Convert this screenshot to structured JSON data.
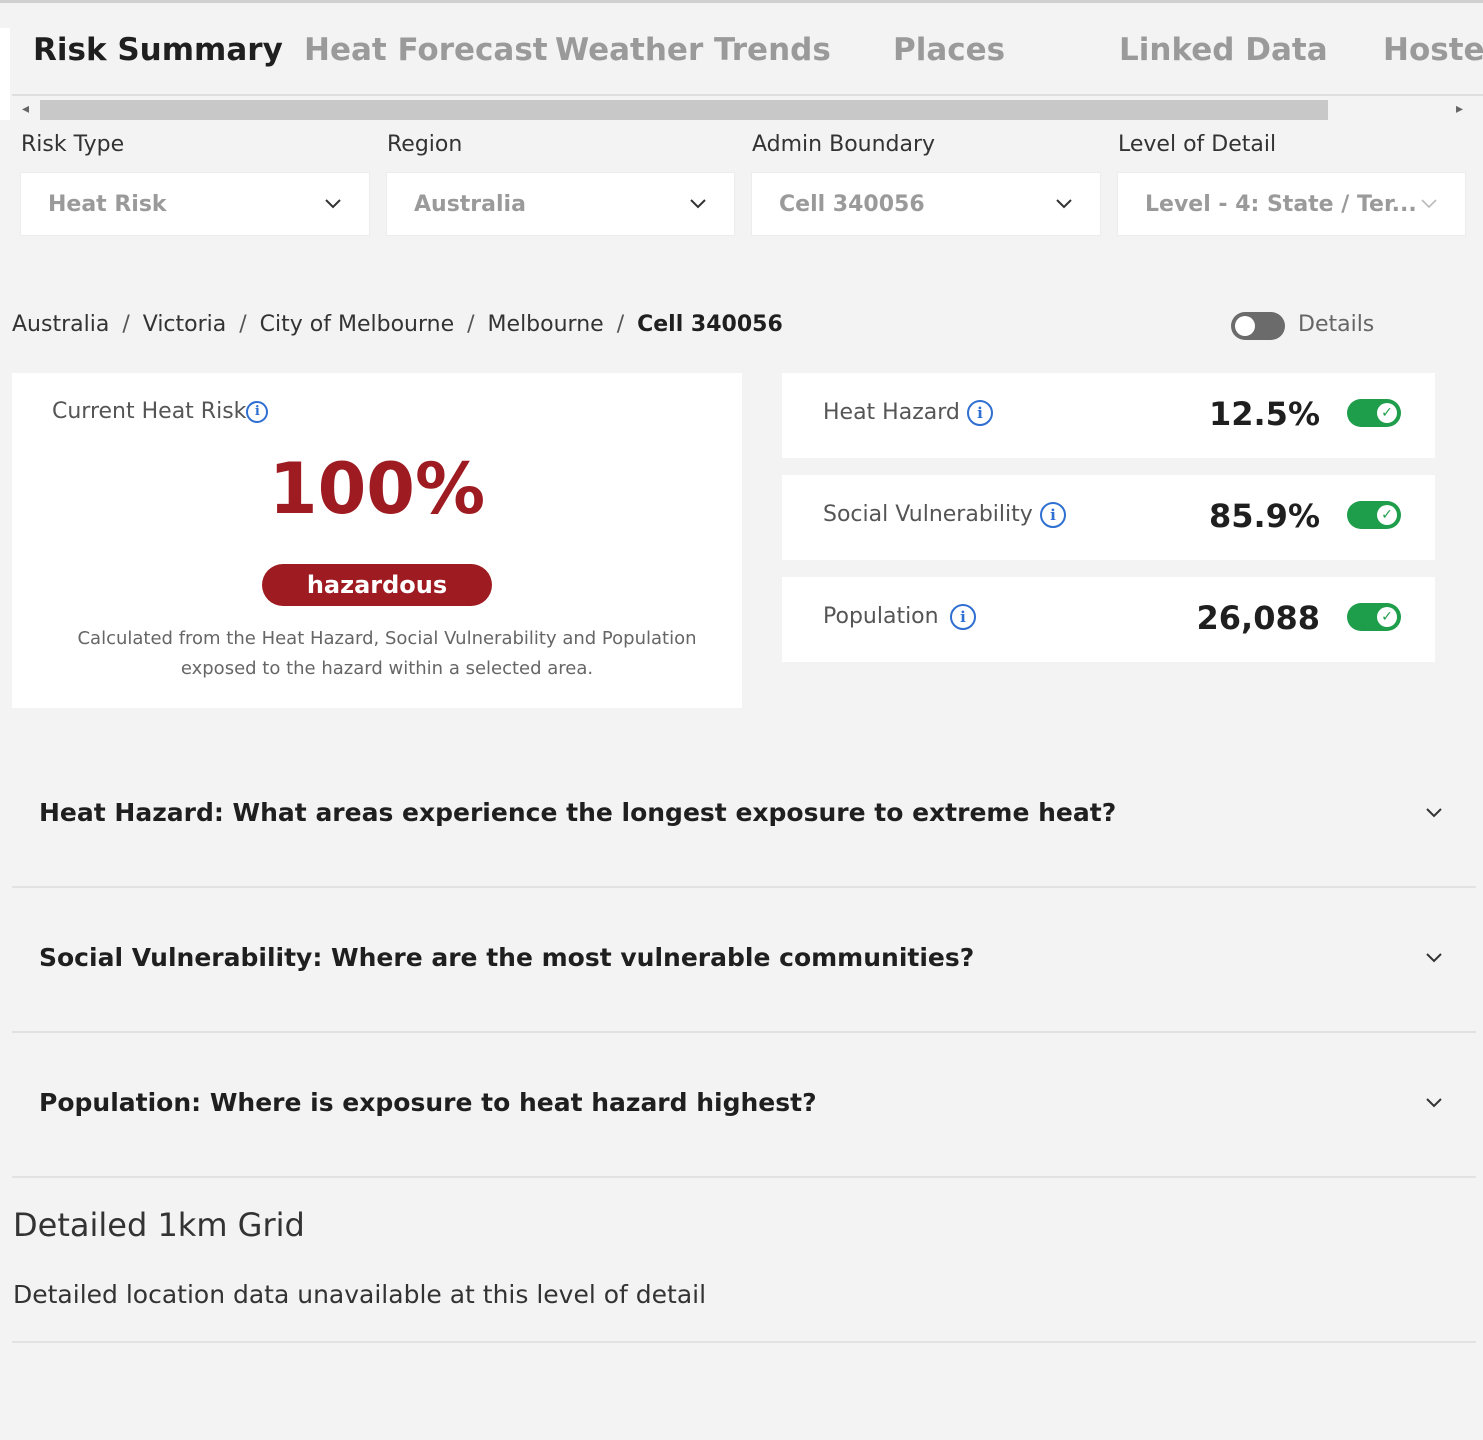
{
  "tabs": [
    {
      "label": "Risk Summary",
      "active": true
    },
    {
      "label": "Heat Forecast",
      "active": false
    },
    {
      "label": "Weather Trends",
      "active": false
    },
    {
      "label": "Places",
      "active": false
    },
    {
      "label": "Linked Data",
      "active": false
    },
    {
      "label": "Hoste",
      "active": false
    }
  ],
  "filters": {
    "risk_type": {
      "label": "Risk Type",
      "value": "Heat Risk"
    },
    "region": {
      "label": "Region",
      "value": "Australia"
    },
    "admin_boundary": {
      "label": "Admin Boundary",
      "value": "Cell 340056"
    },
    "level_of_detail": {
      "label": "Level of Detail",
      "value": "Level - 4: State / Ter..."
    }
  },
  "breadcrumb": {
    "items": [
      "Australia",
      "Victoria",
      "City of Melbourne",
      "Melbourne"
    ],
    "separator": "/",
    "current": "Cell 340056"
  },
  "details_toggle": {
    "label": "Details",
    "on": false
  },
  "risk_card": {
    "title": "Current Heat Risk",
    "value": "100%",
    "badge": "hazardous",
    "description_line1": "Calculated from the Heat Hazard, Social Vulnerability and Population",
    "description_line2": "exposed to the hazard within a selected area."
  },
  "metrics": [
    {
      "label": "Heat Hazard",
      "value": "12.5%",
      "enabled": true
    },
    {
      "label": "Social Vulnerability",
      "value": "85.9%",
      "enabled": true
    },
    {
      "label": "Population",
      "value": "26,088",
      "enabled": true
    }
  ],
  "accordions": [
    {
      "question": "Heat Hazard: What areas experience the longest exposure to extreme heat?"
    },
    {
      "question": "Social Vulnerability: Where are the most vulnerable communities?"
    },
    {
      "question": "Population: Where is exposure to heat hazard highest?"
    }
  ],
  "detailed_grid": {
    "title": "Detailed 1km Grid",
    "message": "Detailed location data unavailable at this level of detail"
  },
  "colors": {
    "accent_red": "#9e1b22",
    "toggle_green": "#1e9e4a",
    "info_blue": "#2f6fd1"
  },
  "icons": {
    "info": "info-icon",
    "chevron": "chevron-down-icon",
    "check": "check-icon"
  }
}
